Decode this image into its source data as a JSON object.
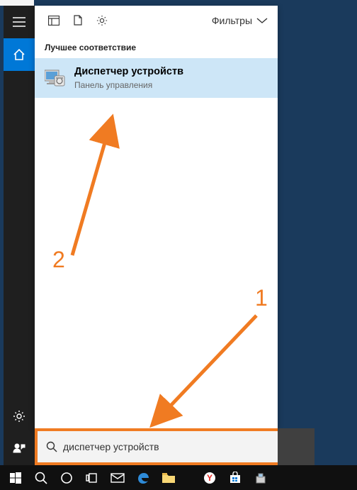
{
  "header": {
    "filters_label": "Фильтры"
  },
  "section": {
    "best_match_label": "Лучшее соответствие"
  },
  "result": {
    "title": "Диспетчер устройств",
    "subtitle": "Панель управления"
  },
  "search": {
    "value": "диспетчер устройств",
    "placeholder": ""
  },
  "annotations": {
    "label1": "1",
    "label2": "2"
  },
  "colors": {
    "highlight": "#cde6f7",
    "accent": "#0078d7",
    "annotation": "#f07b22"
  }
}
